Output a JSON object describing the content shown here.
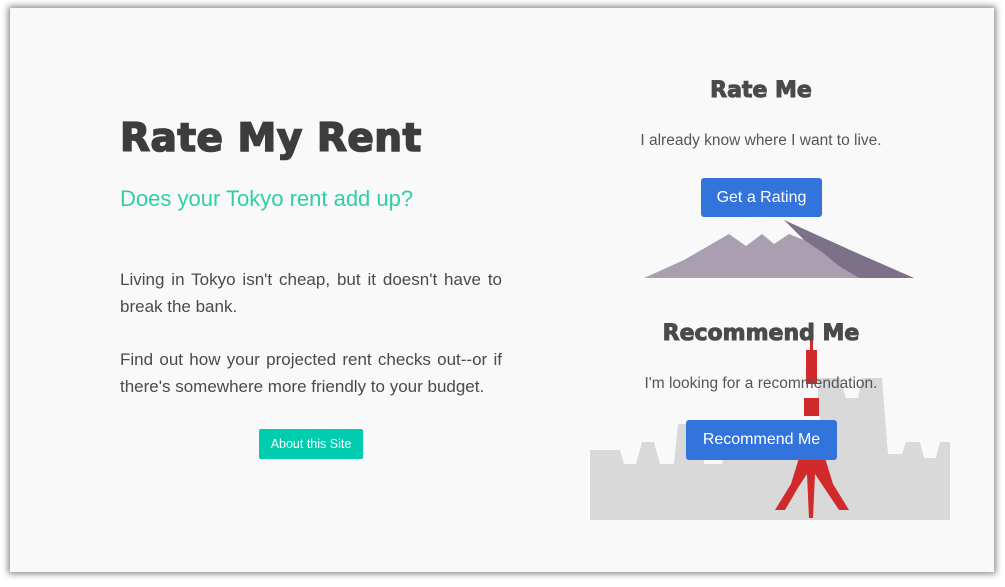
{
  "hero": {
    "title": "Rate My Rent",
    "tagline": "Does your Tokyo rent add up?",
    "paragraphs": [
      "Living in Tokyo isn't cheap, but it doesn't have to break the bank.",
      "Find out how your projected rent checks out--or if there's somewhere more friendly to your budget."
    ],
    "about_button": "About this Site"
  },
  "rate_panel": {
    "heading": "Rate Me",
    "description": "I already know where I want to live.",
    "button": "Get a Rating",
    "illustration": "mount-fuji-illustration"
  },
  "recommend_panel": {
    "heading": "Recommend Me",
    "description": "I'm looking for a recommendation.",
    "button": "Recommend Me",
    "illustration": "tokyo-tower-skyline-illustration"
  },
  "colors": {
    "background": "#f9f9f9",
    "title": "#3d3d3d",
    "tagline": "#2fcfa6",
    "body_text": "#4a4a4a",
    "about_button": "#00cdb0",
    "primary_button": "#3273dc",
    "mountain": "#a99fb0",
    "mountain_shadow": "#7c7189",
    "skyline": "#d9d9d9",
    "tower_red": "#d02a2a"
  }
}
